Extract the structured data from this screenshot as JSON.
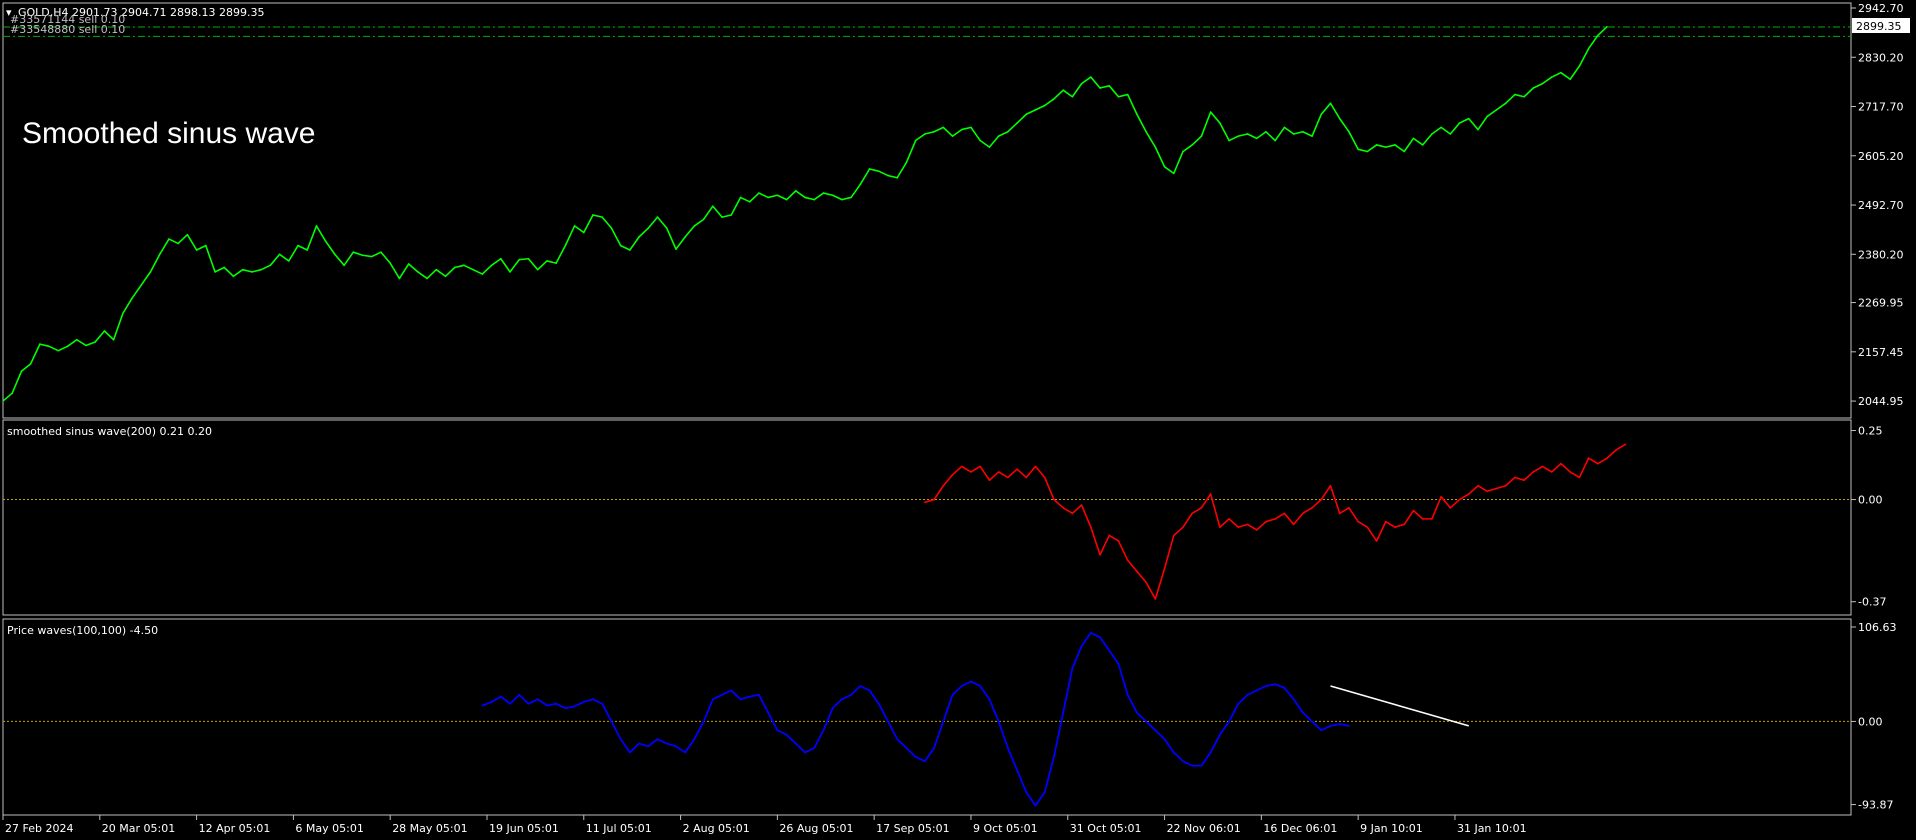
{
  "symbol_line": "GOLD,H4  2901.73 2904.71 2898.13 2899.35",
  "orders": [
    "#33571144 sell 0.10",
    "#33548880 sell 0.10"
  ],
  "annotation": "Smoothed sinus wave",
  "last_price_label": "2899.35",
  "colors": {
    "background": "#000000",
    "frame": "#c0c0c0",
    "text": "#ffffff",
    "price_line": "#00ff00",
    "order_line": "#00b000",
    "sinus": "#ff0000",
    "sinus_highlight": "#ffffff",
    "waves": "#0000ff",
    "trendline": "#ffffff",
    "zero_line": "#c8a000"
  },
  "chart_data": [
    {
      "type": "line",
      "title": "GOLD,H4  2901.73 2904.71 2898.13 2899.35",
      "y_ticks": [
        "2942.70",
        "2830.20",
        "2717.70",
        "2605.20",
        "2492.70",
        "2380.20",
        "2269.95",
        "2157.45",
        "2044.95"
      ],
      "ylim": [
        2020,
        2942.7
      ],
      "order_levels": [
        2899.35,
        2878.0
      ],
      "series": [
        {
          "values": [
            2045,
            2063,
            2113,
            2130,
            2175,
            2170,
            2160,
            2170,
            2185,
            2172,
            2180,
            2205,
            2185,
            2245,
            2280,
            2310,
            2340,
            2380,
            2415,
            2405,
            2425,
            2390,
            2400,
            2340,
            2350,
            2330,
            2345,
            2340,
            2345,
            2355,
            2380,
            2365,
            2400,
            2390,
            2445,
            2410,
            2380,
            2355,
            2385,
            2378,
            2375,
            2385,
            2360,
            2325,
            2358,
            2340,
            2325,
            2345,
            2330,
            2350,
            2355,
            2345,
            2335,
            2355,
            2370,
            2340,
            2368,
            2370,
            2345,
            2365,
            2360,
            2400,
            2445,
            2430,
            2470,
            2465,
            2440,
            2400,
            2390,
            2420,
            2440,
            2465,
            2440,
            2392,
            2420,
            2445,
            2460,
            2490,
            2465,
            2470,
            2510,
            2500,
            2520,
            2510,
            2515,
            2505,
            2525,
            2510,
            2505,
            2520,
            2515,
            2505,
            2510,
            2540,
            2575,
            2570,
            2560,
            2555,
            2590,
            2640,
            2655,
            2660,
            2670,
            2650,
            2665,
            2670,
            2640,
            2625,
            2650,
            2660,
            2680,
            2700,
            2710,
            2720,
            2735,
            2755,
            2740,
            2770,
            2785,
            2760,
            2765,
            2740,
            2745,
            2700,
            2660,
            2625,
            2580,
            2565,
            2615,
            2630,
            2650,
            2705,
            2680,
            2640,
            2650,
            2655,
            2645,
            2660,
            2640,
            2670,
            2655,
            2660,
            2650,
            2700,
            2725,
            2690,
            2660,
            2620,
            2615,
            2630,
            2625,
            2630,
            2615,
            2645,
            2630,
            2655,
            2670,
            2655,
            2680,
            2690,
            2665,
            2695,
            2710,
            2725,
            2745,
            2740,
            2760,
            2770,
            2785,
            2795,
            2780,
            2810,
            2850,
            2880,
            2900
          ]
        }
      ]
    },
    {
      "type": "line",
      "title": "smoothed sinus wave(200) 0.21 0.20",
      "y_ticks": [
        "0.25",
        "0.00",
        "-0.37"
      ],
      "ylim": [
        -0.4,
        0.27
      ],
      "start_index": 100,
      "series": [
        {
          "values": [
            -0.01,
            0.0,
            0.05,
            0.09,
            0.12,
            0.1,
            0.12,
            0.07,
            0.1,
            0.08,
            0.11,
            0.08,
            0.12,
            0.08,
            0.0,
            -0.03,
            -0.05,
            -0.02,
            -0.1,
            -0.2,
            -0.13,
            -0.15,
            -0.22,
            -0.26,
            -0.3,
            -0.36,
            -0.25,
            -0.13,
            -0.1,
            -0.05,
            -0.03,
            0.02,
            -0.1,
            -0.07,
            -0.1,
            -0.09,
            -0.11,
            -0.08,
            -0.07,
            -0.05,
            -0.09,
            -0.05,
            -0.03,
            0.0,
            0.05,
            -0.05,
            -0.03,
            -0.08,
            -0.1,
            -0.15,
            -0.08,
            -0.1,
            -0.09,
            -0.04,
            -0.07,
            -0.07,
            0.01,
            -0.03,
            0.0,
            0.02,
            0.05,
            0.03,
            0.04,
            0.05,
            0.08,
            0.07,
            0.1,
            0.12,
            0.1,
            0.13,
            0.1,
            0.08,
            0.15,
            0.13,
            0.15,
            0.18,
            0.2
          ]
        }
      ]
    },
    {
      "type": "line",
      "title": "Price waves(100,100) -4.50",
      "y_ticks": [
        "106.63",
        "0.00",
        "-93.87"
      ],
      "ylim": [
        -100,
        110
      ],
      "start_index": 52,
      "series": [
        {
          "values": [
            18,
            22,
            28,
            20,
            30,
            20,
            25,
            18,
            20,
            15,
            17,
            22,
            25,
            20,
            0,
            -20,
            -35,
            -25,
            -28,
            -20,
            -25,
            -28,
            -35,
            -20,
            0,
            25,
            30,
            35,
            25,
            28,
            30,
            10,
            -10,
            -15,
            -25,
            -35,
            -30,
            -10,
            15,
            25,
            30,
            40,
            35,
            20,
            0,
            -20,
            -30,
            -40,
            -45,
            -30,
            0,
            30,
            40,
            45,
            40,
            25,
            0,
            -30,
            -55,
            -80,
            -95,
            -80,
            -40,
            10,
            60,
            85,
            100,
            95,
            80,
            65,
            30,
            10,
            0,
            -10,
            -20,
            -35,
            -45,
            -50,
            -50,
            -35,
            -15,
            0,
            20,
            30,
            35,
            40,
            42,
            38,
            25,
            10,
            0,
            -10,
            -5,
            -3,
            -5
          ]
        }
      ],
      "trendline": {
        "from": {
          "x": 144,
          "y": 40
        },
        "to": {
          "x": 159,
          "y": -5
        }
      }
    }
  ],
  "x_axis": {
    "labels": [
      "27 Feb 2024",
      "20 Mar 05:01",
      "12 Apr 05:01",
      "6 May 05:01",
      "28 May 05:01",
      "19 Jun 05:01",
      "11 Jul 05:01",
      "2 Aug 05:01",
      "26 Aug 05:01",
      "17 Sep 05:01",
      "9 Oct 05:01",
      "31 Oct 05:01",
      "22 Nov 06:01",
      "16 Dec 06:01",
      "9 Jan 10:01",
      "31 Jan 10:01"
    ],
    "label_index": [
      0,
      10.5,
      21,
      31.5,
      42,
      52.5,
      63,
      73.5,
      84,
      94.5,
      105,
      115.5,
      126,
      136.5,
      147,
      157.5
    ]
  }
}
